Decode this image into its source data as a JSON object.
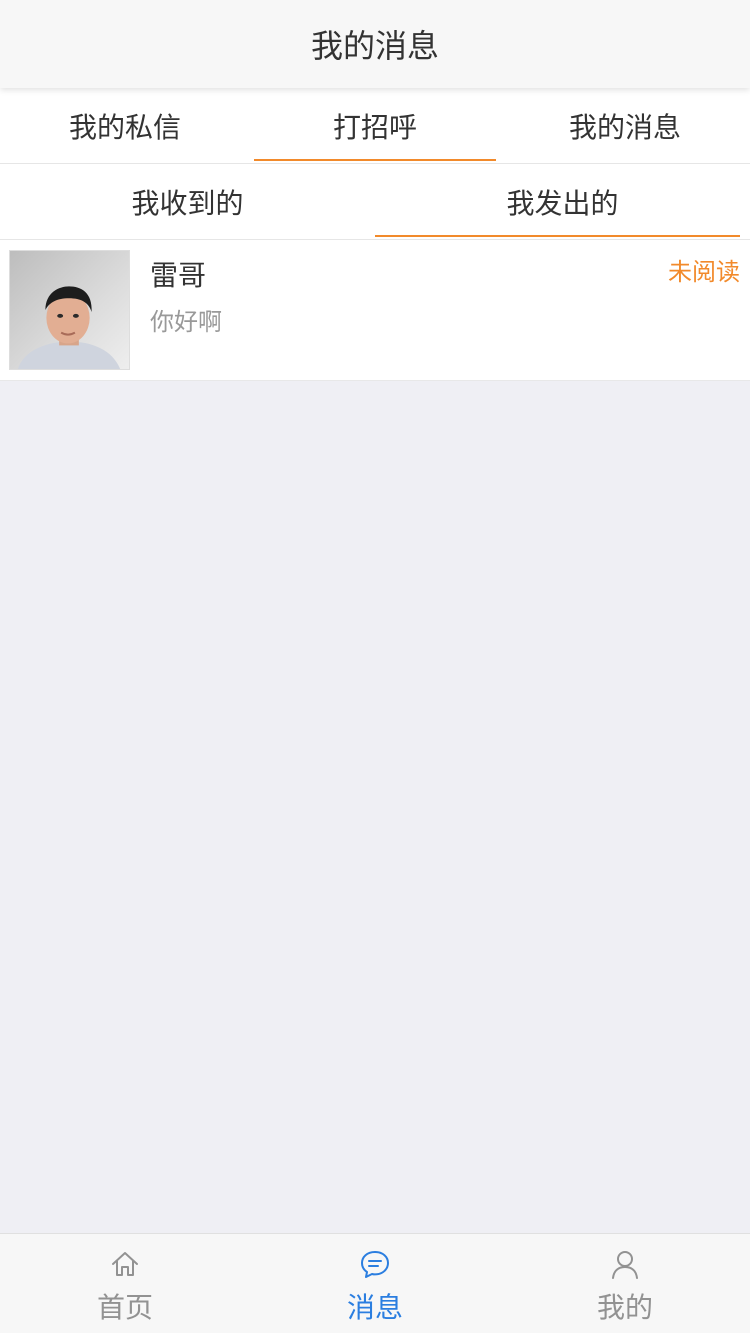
{
  "header": {
    "title": "我的消息"
  },
  "tabs_primary": [
    {
      "label": "我的私信",
      "active": false
    },
    {
      "label": "打招呼",
      "active": true
    },
    {
      "label": "我的消息",
      "active": false
    }
  ],
  "tabs_secondary": [
    {
      "label": "我收到的",
      "active": false
    },
    {
      "label": "我发出的",
      "active": true
    }
  ],
  "messages": [
    {
      "name": "雷哥",
      "preview": "你好啊",
      "status": "未阅读",
      "avatar": "person-photo"
    }
  ],
  "tabbar": [
    {
      "label": "首页",
      "icon": "home-icon",
      "active": false
    },
    {
      "label": "消息",
      "icon": "message-icon",
      "active": true
    },
    {
      "label": "我的",
      "icon": "user-icon",
      "active": false
    }
  ],
  "colors": {
    "accent": "#f28a2b",
    "active_tab": "#2b7ee0",
    "background": "#efeff4"
  }
}
